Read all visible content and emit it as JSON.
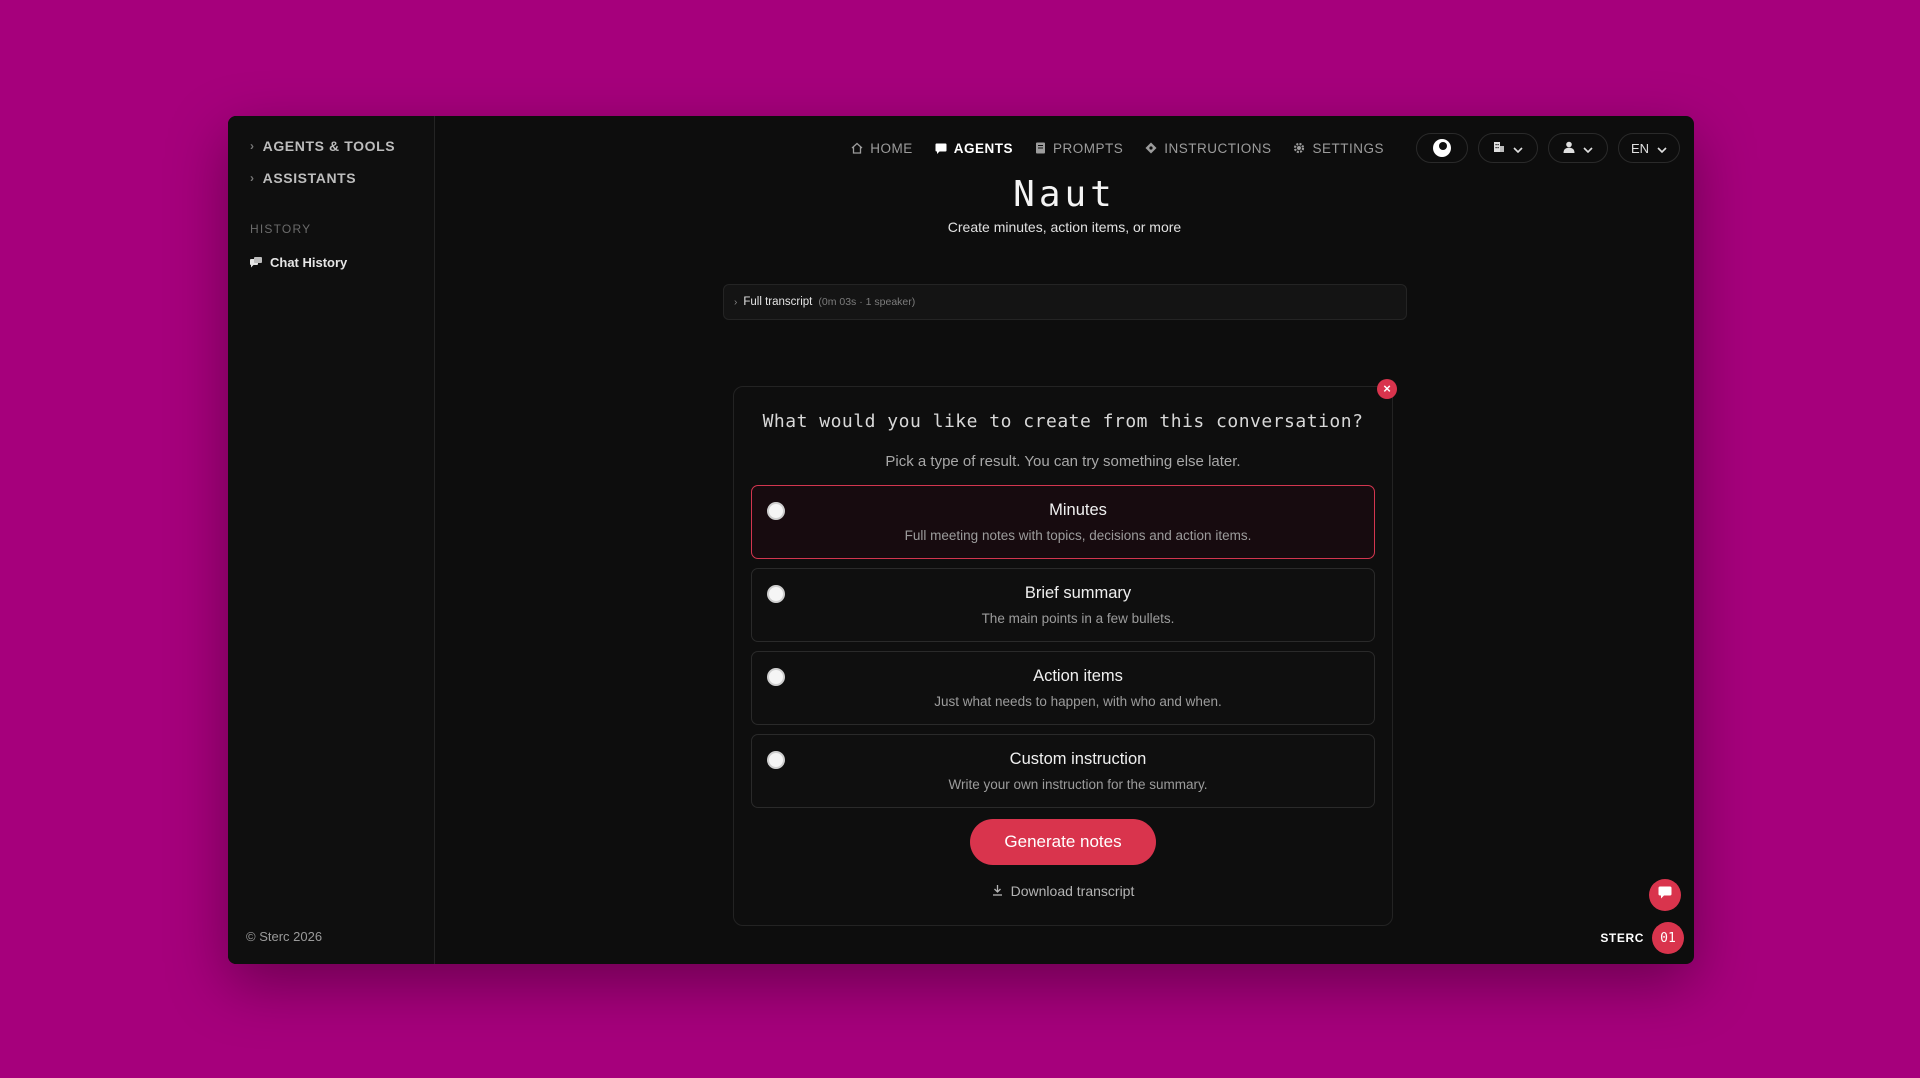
{
  "sidebar": {
    "sections": [
      {
        "label": "AGENTS & TOOLS"
      },
      {
        "label": "ASSISTANTS"
      }
    ],
    "history_label": "HISTORY",
    "chat_history_label": "Chat History",
    "footer": "© Sterc 2026"
  },
  "nav": {
    "items": [
      {
        "label": "HOME",
        "icon": "home-icon"
      },
      {
        "label": "AGENTS",
        "icon": "chat-icon",
        "active": true
      },
      {
        "label": "PROMPTS",
        "icon": "document-icon"
      },
      {
        "label": "INSTRUCTIONS",
        "icon": "diamond-icon"
      },
      {
        "label": "SETTINGS",
        "icon": "gear-icon"
      }
    ],
    "language": "EN"
  },
  "header": {
    "title": "Naut",
    "subtitle": "Create minutes, action items, or more"
  },
  "transcript": {
    "label": "Full transcript",
    "meta": "(0m 03s · 1 speaker)"
  },
  "modal": {
    "question": "What would you like to create from this conversation?",
    "hint": "Pick a type of result. You can try something else later.",
    "options": [
      {
        "title": "Minutes",
        "description": "Full meeting notes with topics, decisions and action items.",
        "selected": true
      },
      {
        "title": "Brief summary",
        "description": "The main points in a few bullets.",
        "selected": false
      },
      {
        "title": "Action items",
        "description": "Just what needs to happen, with who and when.",
        "selected": false
      },
      {
        "title": "Custom instruction",
        "description": "Write your own instruction for the summary.",
        "selected": false
      }
    ],
    "generate_label": "Generate notes",
    "download_label": "Download transcript",
    "close_symbol": "×"
  },
  "branding": {
    "name": "STERC",
    "badge": "01"
  },
  "colors": {
    "background": "#a6007c",
    "accent": "#d9344d",
    "panel": "#0d0d0d"
  }
}
